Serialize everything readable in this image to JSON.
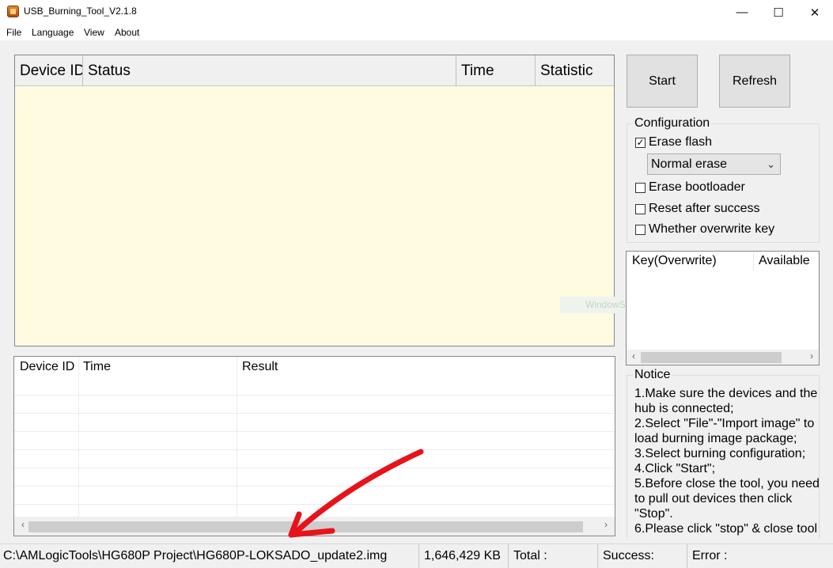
{
  "window": {
    "title": "USB_Burning_Tool_V2.1.8",
    "controls": {
      "minimize": "—",
      "maximize": "☐",
      "close": "✕"
    }
  },
  "menu": [
    "File",
    "Language",
    "View",
    "About"
  ],
  "device_table": {
    "headers": [
      "Device ID",
      "Status",
      "Time",
      "Statistic"
    ]
  },
  "result_table": {
    "headers": [
      "Device ID",
      "Time",
      "Result"
    ]
  },
  "buttons": {
    "start": "Start",
    "refresh": "Refresh"
  },
  "configuration": {
    "title": "Configuration",
    "erase_flash": {
      "label": "Erase flash",
      "checked": true
    },
    "erase_mode": "Normal erase",
    "erase_bootloader": {
      "label": "Erase bootloader",
      "checked": false
    },
    "reset_after_success": {
      "label": "Reset after success",
      "checked": false
    },
    "overwrite_key": {
      "label": "Whether overwrite key",
      "checked": false
    }
  },
  "key_list": {
    "headers": [
      "Key(Overwrite)",
      "Available"
    ]
  },
  "notice": {
    "title": "Notice",
    "lines": [
      "1.Make sure the devices and the",
      "hub is connected;",
      "2.Select \"File\"-\"Import image\" to",
      "load burning image package;",
      "3.Select burning configuration;",
      "4.Click \"Start\";",
      "5.Before close the tool, you need",
      "to pull out devices then click",
      "\"Stop\".",
      "6.Please click \"stop\" & close tool"
    ]
  },
  "watermark": "WindowSnip",
  "statusbar": {
    "path": "C:\\AMLogicTools\\HG680P Project\\HG680P-LOKSADO_update2.img",
    "size": "1,646,429 KB",
    "total": "Total :",
    "success": "Success:",
    "error": "Error :"
  },
  "colors": {
    "device_table_bg": "#fffbe0",
    "annotation_arrow": "#e8121a"
  }
}
